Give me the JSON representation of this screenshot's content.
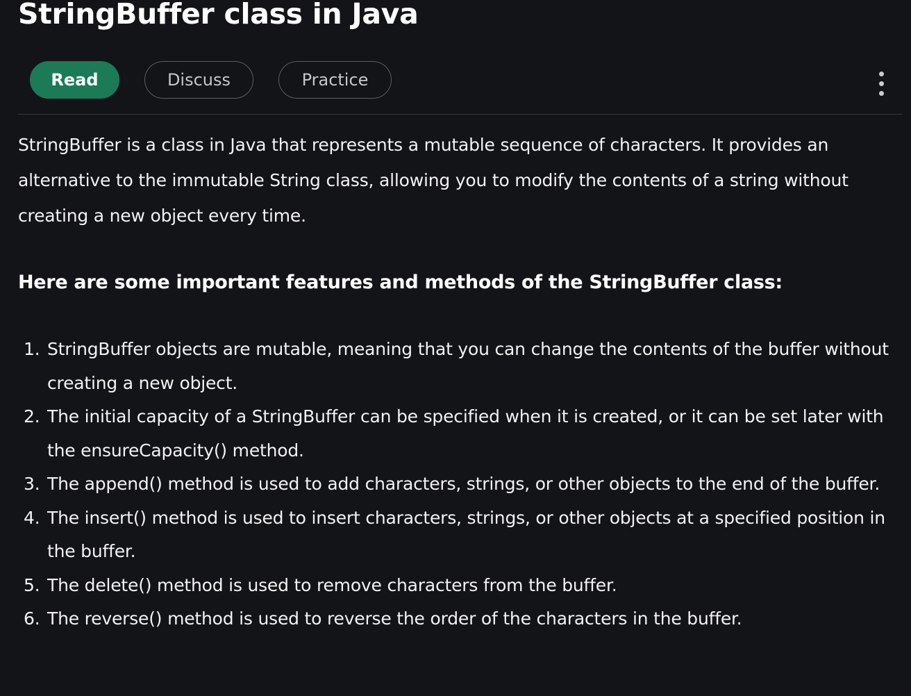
{
  "article": {
    "title": "StringBuffer class in Java",
    "intro": "StringBuffer is a class in Java that represents a mutable sequence of characters. It provides an alternative to the immutable String class, allowing you to modify the contents of a string without creating a new object every time.",
    "subheading": "Here are some important features and methods of the StringBuffer class:",
    "features": [
      {
        "num": "1.",
        "text": "StringBuffer objects are mutable, meaning that you can change the contents of the buffer without creating a new object."
      },
      {
        "num": "2.",
        "text": "The initial capacity of a StringBuffer can be specified when it is created, or it can be set later with the ensureCapacity() method."
      },
      {
        "num": "3.",
        "text": "The append() method is used to add characters, strings, or other objects to the end of the buffer."
      },
      {
        "num": "4.",
        "text": "The insert() method is used to insert characters, strings, or other objects at a specified position in the buffer."
      },
      {
        "num": "5.",
        "text": "The delete() method is used to remove characters from the buffer."
      },
      {
        "num": "6.",
        "text": "The reverse() method is used to reverse the order of the characters in the buffer."
      }
    ]
  },
  "tabs": [
    {
      "label": "Read",
      "active": true
    },
    {
      "label": "Discuss",
      "active": false
    },
    {
      "label": "Practice",
      "active": false
    }
  ],
  "menu": {
    "icon": "more-vertical-icon"
  },
  "colors": {
    "background": "#131417",
    "active_tab": "#1a7b56",
    "tab_border": "#5a5d62",
    "text": "#f2f2f2"
  }
}
